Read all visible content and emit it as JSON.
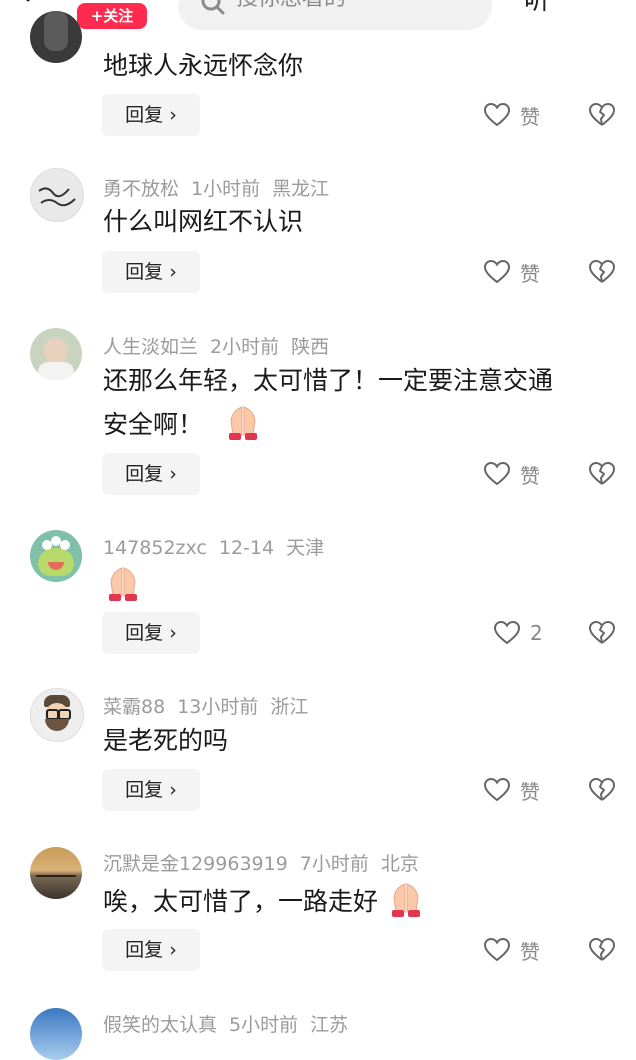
{
  "header": {
    "follow_label": "+关注",
    "search_placeholder": "搜你想看的",
    "right_label": "听"
  },
  "comments": [
    {
      "user": "",
      "time": "",
      "location": "",
      "text": "地球人永远怀念你",
      "reply_label": "回复 ›",
      "like_label": "赞"
    },
    {
      "user": "勇不放松",
      "time": "1小时前",
      "location": "黑龙江",
      "text": "什么叫网红不认识",
      "reply_label": "回复 ›",
      "like_label": "赞"
    },
    {
      "user": "人生淡如兰",
      "time": "2小时前",
      "location": "陕西",
      "text": "还那么年轻，太可惜了！一定要注意交通",
      "text2": "安全啊！",
      "reply_label": "回复 ›",
      "like_label": "赞"
    },
    {
      "user": "147852zxc",
      "time": "12-14",
      "location": "天津",
      "text": "",
      "reply_label": "回复 ›",
      "like_label": "2"
    },
    {
      "user": "菜霸88",
      "time": "13小时前",
      "location": "浙江",
      "text": "是老死的吗",
      "reply_label": "回复 ›",
      "like_label": "赞"
    },
    {
      "user": "沉默是金129963919",
      "time": "7小时前",
      "location": "北京",
      "text": "唉，太可惜了，一路走好",
      "reply_label": "回复 ›",
      "like_label": "赞"
    },
    {
      "user": "假笑的太认真",
      "time": "5小时前",
      "location": "江苏"
    }
  ],
  "icons": {
    "pray_emoji": "pray-emoji",
    "heart": "heart-icon",
    "dislike": "broken-heart-icon"
  },
  "colors": {
    "follow_bg": "#ff2b4f",
    "meta_gray": "#9b9b9b",
    "reply_bg": "#f4f4f4"
  }
}
